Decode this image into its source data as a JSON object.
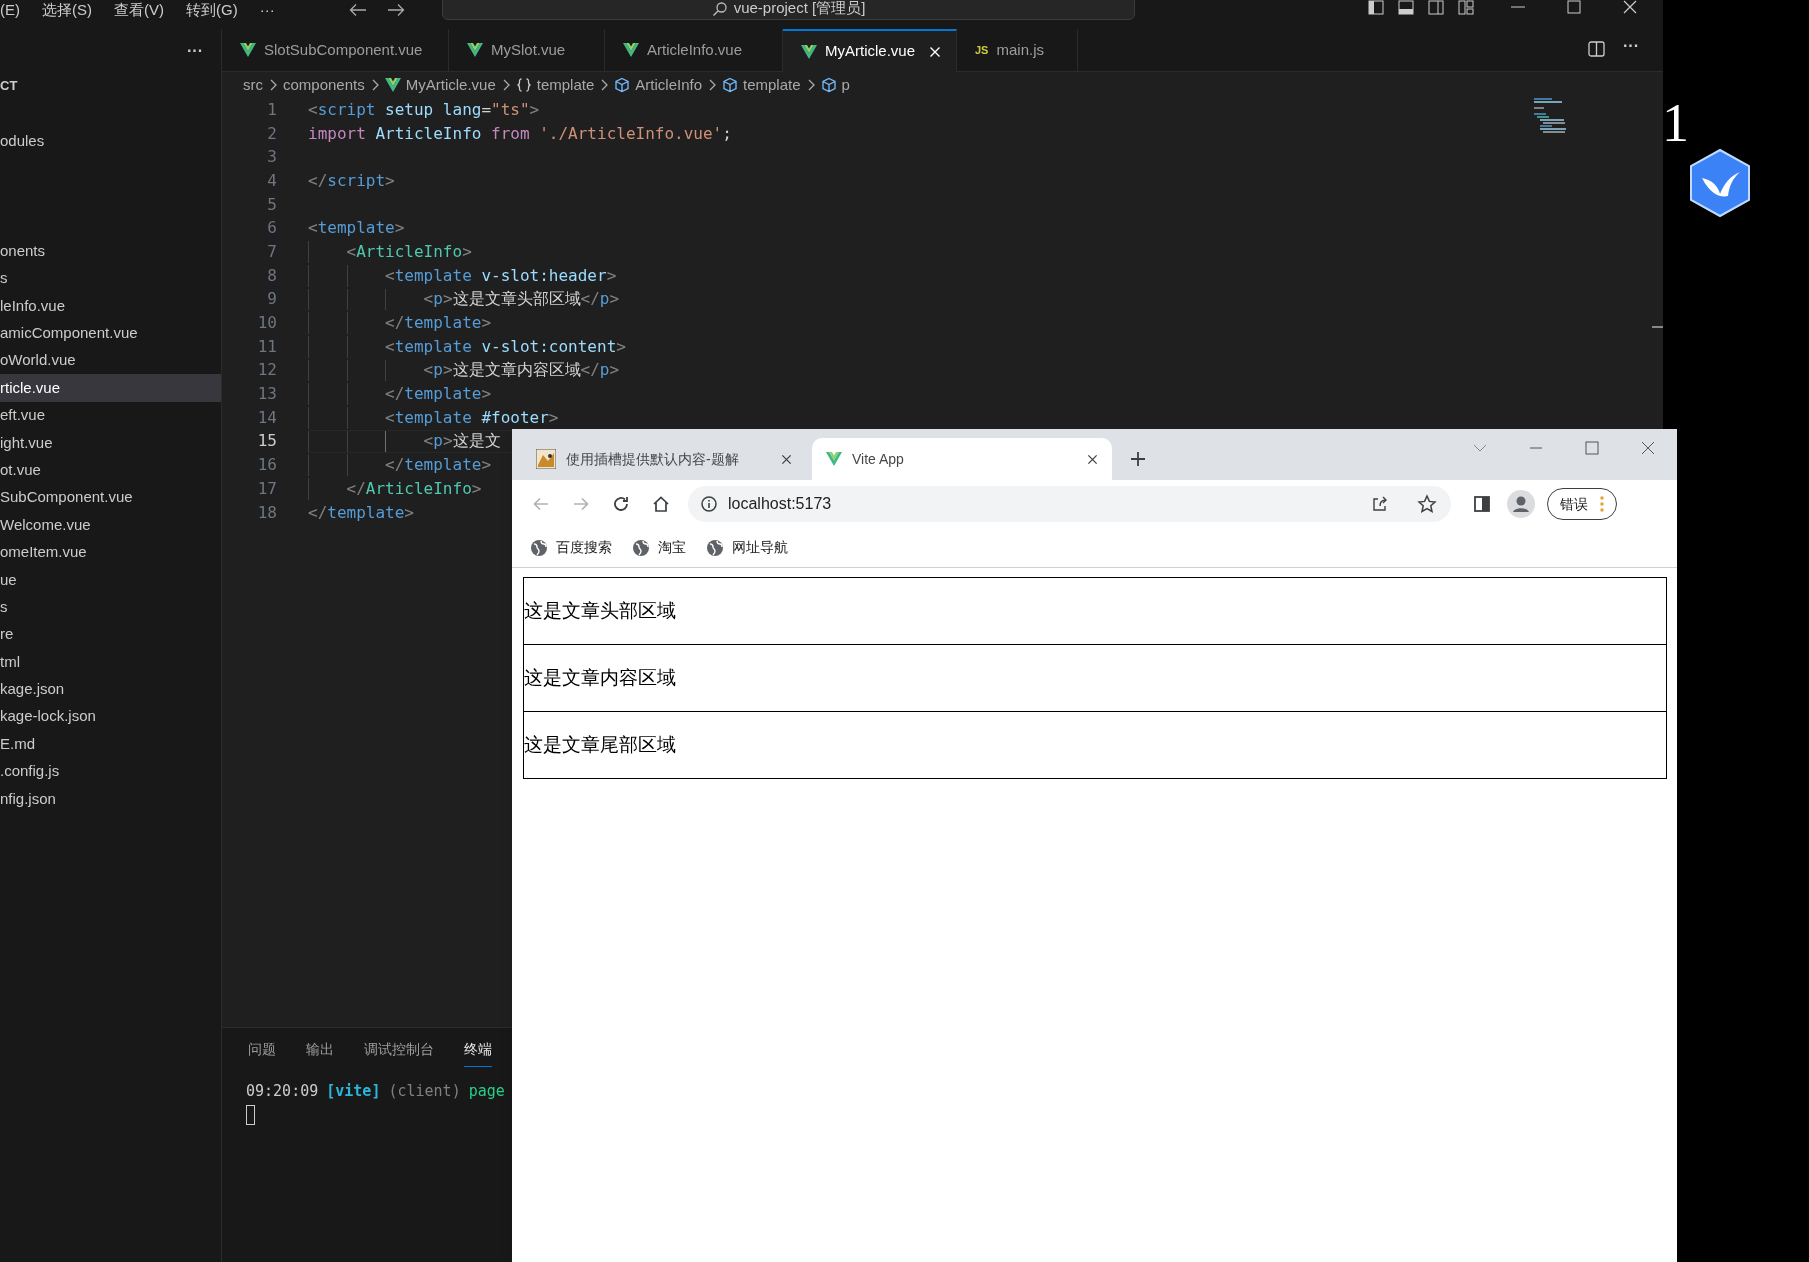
{
  "title_bar": {
    "menus": [
      "(E)",
      "选择(S)",
      "查看(V)",
      "转到(G)",
      "···"
    ],
    "search": "vue-project [管理员]"
  },
  "explorer": {
    "more": "···",
    "header": "CT",
    "items": [
      {
        "label": "odules",
        "selected": false
      },
      {
        "label": "onents",
        "selected": false
      },
      {
        "label": "s",
        "selected": false
      },
      {
        "label": "leInfo.vue",
        "selected": false
      },
      {
        "label": "amicComponent.vue",
        "selected": false
      },
      {
        "label": "oWorld.vue",
        "selected": false
      },
      {
        "label": "rticle.vue",
        "selected": true
      },
      {
        "label": "eft.vue",
        "selected": false
      },
      {
        "label": "ight.vue",
        "selected": false
      },
      {
        "label": "ot.vue",
        "selected": false
      },
      {
        "label": "SubComponent.vue",
        "selected": false
      },
      {
        "label": "Welcome.vue",
        "selected": false
      },
      {
        "label": "omeItem.vue",
        "selected": false
      },
      {
        "label": "ue",
        "selected": false
      },
      {
        "label": "s",
        "selected": false
      },
      {
        "label": "re",
        "selected": false
      },
      {
        "label": "tml",
        "selected": false
      },
      {
        "label": "kage.json",
        "selected": false
      },
      {
        "label": "kage-lock.json",
        "selected": false
      },
      {
        "label": "E.md",
        "selected": false
      },
      {
        "label": ".config.js",
        "selected": false
      },
      {
        "label": "nfig.json",
        "selected": false
      }
    ]
  },
  "editor_tabs": [
    {
      "label": "SlotSubComponent.vue",
      "kind": "vue",
      "selected": false
    },
    {
      "label": "MySlot.vue",
      "kind": "vue",
      "selected": false
    },
    {
      "label": "ArticleInfo.vue",
      "kind": "vue",
      "selected": false
    },
    {
      "label": "MyArticle.vue",
      "kind": "vue",
      "selected": true
    },
    {
      "label": "main.js",
      "kind": "js",
      "badge": "JS",
      "selected": false
    }
  ],
  "breadcrumb": [
    {
      "label": "src",
      "kind": "folder"
    },
    {
      "label": "components",
      "kind": "folder"
    },
    {
      "label": "MyArticle.vue",
      "kind": "vue"
    },
    {
      "label": "template",
      "kind": "braces"
    },
    {
      "label": "ArticleInfo",
      "kind": "cube"
    },
    {
      "label": "template",
      "kind": "cube"
    },
    {
      "label": "p",
      "kind": "cube"
    }
  ],
  "code_lines": [
    {
      "number": "1",
      "current": false,
      "tokens": [
        {
          "kind": "punct",
          "text": "<"
        },
        {
          "kind": "tag",
          "text": "script"
        },
        {
          "kind": "attr",
          "text": " setup lang"
        },
        {
          "kind": "op",
          "text": "="
        },
        {
          "kind": "str",
          "text": "\"ts\""
        },
        {
          "kind": "punct",
          "text": ">"
        }
      ]
    },
    {
      "number": "2",
      "current": false,
      "tokens": [
        {
          "kind": "kw",
          "text": "import"
        },
        {
          "kind": "ident",
          "text": " ArticleInfo"
        },
        {
          "kind": "kw",
          "text": " from"
        },
        {
          "kind": "str",
          "text": " './ArticleInfo.vue'"
        },
        {
          "kind": "op",
          "text": ";"
        }
      ]
    },
    {
      "number": "3",
      "current": false
    },
    {
      "number": "4",
      "current": false,
      "tokens": [
        {
          "kind": "punct",
          "text": "</"
        },
        {
          "kind": "tag",
          "text": "script"
        },
        {
          "kind": "punct",
          "text": ">"
        }
      ]
    },
    {
      "number": "5",
      "current": false
    },
    {
      "number": "6",
      "current": false,
      "tokens": [
        {
          "kind": "punct",
          "text": "<"
        },
        {
          "kind": "tag",
          "text": "template"
        },
        {
          "kind": "punct",
          "text": ">"
        }
      ]
    },
    {
      "number": "7",
      "current": false,
      "tokens": [
        {
          "kind": "punct",
          "text": "    <"
        },
        {
          "kind": "comp",
          "text": "ArticleInfo"
        },
        {
          "kind": "punct",
          "text": ">"
        }
      ]
    },
    {
      "number": "8",
      "current": false,
      "tokens": [
        {
          "kind": "punct",
          "text": "        <"
        },
        {
          "kind": "tag",
          "text": "template"
        },
        {
          "kind": "attr",
          "text": " v-slot:header"
        },
        {
          "kind": "punct",
          "text": ">"
        }
      ]
    },
    {
      "number": "9",
      "current": false,
      "tokens": [
        {
          "kind": "punct",
          "text": "            <"
        },
        {
          "kind": "tag",
          "text": "p"
        },
        {
          "kind": "punct",
          "text": ">"
        },
        {
          "kind": "text",
          "text": "这是文章头部区域"
        },
        {
          "kind": "punct",
          "text": "</"
        },
        {
          "kind": "tag",
          "text": "p"
        },
        {
          "kind": "punct",
          "text": ">"
        }
      ]
    },
    {
      "number": "10",
      "current": false,
      "tokens": [
        {
          "kind": "punct",
          "text": "        </"
        },
        {
          "kind": "tag",
          "text": "template"
        },
        {
          "kind": "punct",
          "text": ">"
        }
      ]
    },
    {
      "number": "11",
      "current": false,
      "tokens": [
        {
          "kind": "punct",
          "text": "        <"
        },
        {
          "kind": "tag",
          "text": "template"
        },
        {
          "kind": "attr",
          "text": " v-slot:content"
        },
        {
          "kind": "punct",
          "text": ">"
        }
      ]
    },
    {
      "number": "12",
      "current": false,
      "tokens": [
        {
          "kind": "punct",
          "text": "            <"
        },
        {
          "kind": "tag",
          "text": "p"
        },
        {
          "kind": "punct",
          "text": ">"
        },
        {
          "kind": "text",
          "text": "这是文章内容区域"
        },
        {
          "kind": "punct",
          "text": "</"
        },
        {
          "kind": "tag",
          "text": "p"
        },
        {
          "kind": "punct",
          "text": ">"
        }
      ]
    },
    {
      "number": "13",
      "current": false,
      "tokens": [
        {
          "kind": "punct",
          "text": "        </"
        },
        {
          "kind": "tag",
          "text": "template"
        },
        {
          "kind": "punct",
          "text": ">"
        }
      ]
    },
    {
      "number": "14",
      "current": false,
      "tokens": [
        {
          "kind": "punct",
          "text": "        <"
        },
        {
          "kind": "tag",
          "text": "template"
        },
        {
          "kind": "attr",
          "text": " #footer"
        },
        {
          "kind": "punct",
          "text": ">"
        }
      ]
    },
    {
      "number": "15",
      "current": true,
      "tokens": [
        {
          "kind": "punct",
          "text": "            <"
        },
        {
          "kind": "tag",
          "text": "p"
        },
        {
          "kind": "punct",
          "text": ">"
        },
        {
          "kind": "text",
          "text": "这是文"
        }
      ]
    },
    {
      "number": "16",
      "current": false,
      "tokens": [
        {
          "kind": "punct",
          "text": "        </"
        },
        {
          "kind": "tag",
          "text": "template"
        },
        {
          "kind": "punct",
          "text": ">"
        }
      ]
    },
    {
      "number": "17",
      "current": false,
      "tokens": [
        {
          "kind": "punct",
          "text": "    </"
        },
        {
          "kind": "comp",
          "text": "ArticleInfo"
        },
        {
          "kind": "punct",
          "text": ">"
        }
      ]
    },
    {
      "number": "18",
      "current": false,
      "tokens": [
        {
          "kind": "punct",
          "text": "</"
        },
        {
          "kind": "tag",
          "text": "template"
        },
        {
          "kind": "punct",
          "text": ">"
        }
      ]
    }
  ],
  "panel": {
    "tabs": [
      {
        "label": "问题",
        "selected": false
      },
      {
        "label": "输出",
        "selected": false
      },
      {
        "label": "调试控制台",
        "selected": false
      },
      {
        "label": "终端",
        "selected": true
      }
    ],
    "terminal": {
      "time": "09:20:09",
      "tag": "[vite]",
      "source": "(client)",
      "message": "page"
    }
  },
  "browser": {
    "tabs": [
      {
        "title": "使用插槽提供默认内容-题解",
        "kind": "picture",
        "selected": false
      },
      {
        "title": "Vite App",
        "kind": "vue",
        "selected": true
      }
    ],
    "address": "localhost:5173",
    "error_button": "错误",
    "bookmarks": [
      "百度搜索",
      "淘宝",
      "网址导航"
    ],
    "content_rows": [
      "这是文章头部区域",
      "这是文章内容区域",
      "这是文章尾部区域"
    ]
  },
  "desktop": {
    "digit": "1"
  }
}
